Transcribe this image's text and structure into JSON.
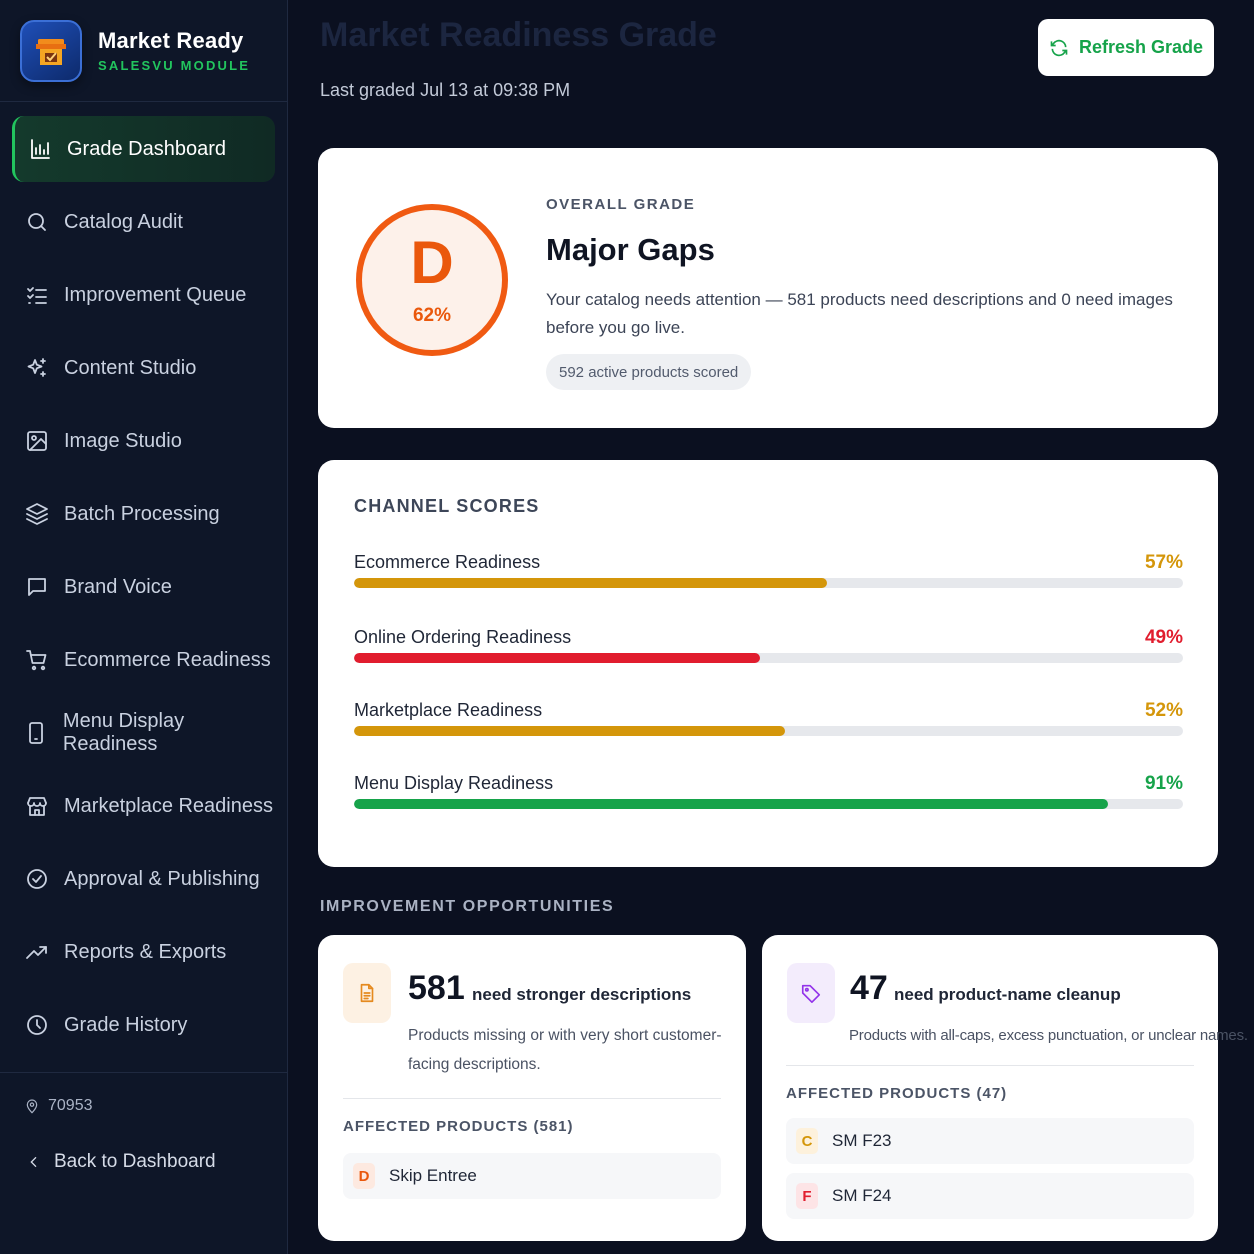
{
  "brand": {
    "title": "Market Ready",
    "subtitle": "SALESVU MODULE"
  },
  "sidebar": {
    "items": [
      {
        "label": "Grade Dashboard",
        "icon": "bar-chart-icon",
        "active": true
      },
      {
        "label": "Catalog Audit",
        "icon": "search-icon"
      },
      {
        "label": "Improvement Queue",
        "icon": "checklist-icon"
      },
      {
        "label": "Content Studio",
        "icon": "sparkles-icon"
      },
      {
        "label": "Image Studio",
        "icon": "image-icon"
      },
      {
        "label": "Batch Processing",
        "icon": "layers-icon"
      },
      {
        "label": "Brand Voice",
        "icon": "message-square-icon"
      },
      {
        "label": "Ecommerce Readiness",
        "icon": "shopping-cart-icon"
      },
      {
        "label": "Menu Display Readiness",
        "icon": "tablet-icon"
      },
      {
        "label": "Marketplace Readiness",
        "icon": "storefront-icon"
      },
      {
        "label": "Approval & Publishing",
        "icon": "check-circle-icon"
      },
      {
        "label": "Reports & Exports",
        "icon": "trending-up-icon"
      },
      {
        "label": "Grade History",
        "icon": "clock-icon"
      }
    ],
    "store_id": "70953",
    "back_label": "Back to Dashboard"
  },
  "header": {
    "title": "Market Readiness Grade",
    "last_graded": "Last graded Jul 13 at 09:38 PM",
    "refresh_label": "Refresh Grade"
  },
  "grade": {
    "letter": "D",
    "percent": "62%",
    "label": "OVERALL GRADE",
    "title": "Major Gaps",
    "description": "Your catalog needs attention — 581 products need descriptions and 0 need images before you go live.",
    "chip": "592 active products scored",
    "color": "#ea580c"
  },
  "channels": {
    "heading": "CHANNEL SCORES",
    "items": [
      {
        "name": "Ecommerce Readiness",
        "value": "57%",
        "fraction": 0.57,
        "color": "#d4960a"
      },
      {
        "name": "Online Ordering Readiness",
        "value": "49%",
        "fraction": 0.49,
        "color": "#e11d2e"
      },
      {
        "name": "Marketplace Readiness",
        "value": "52%",
        "fraction": 0.52,
        "color": "#d4960a"
      },
      {
        "name": "Menu Display Readiness",
        "value": "91%",
        "fraction": 0.91,
        "color": "#16a34a"
      }
    ]
  },
  "opportunities": {
    "heading": "IMPROVEMENT OPPORTUNITIES",
    "cards": [
      {
        "count": "581",
        "what": "need stronger descriptions",
        "description": "Products missing or with very short customer-facing descriptions.",
        "icon": "document-icon",
        "affected_label": "AFFECTED PRODUCTS (581)",
        "products": [
          {
            "grade": "D",
            "name": "Skip Entree"
          }
        ]
      },
      {
        "count": "47",
        "what": "need product-name cleanup",
        "description": "Products with all-caps, excess punctuation, or unclear names.",
        "icon": "tag-icon",
        "affected_label": "AFFECTED PRODUCTS (47)",
        "products": [
          {
            "grade": "C",
            "name": "SM F23"
          },
          {
            "grade": "F",
            "name": "SM F24"
          }
        ]
      }
    ]
  }
}
